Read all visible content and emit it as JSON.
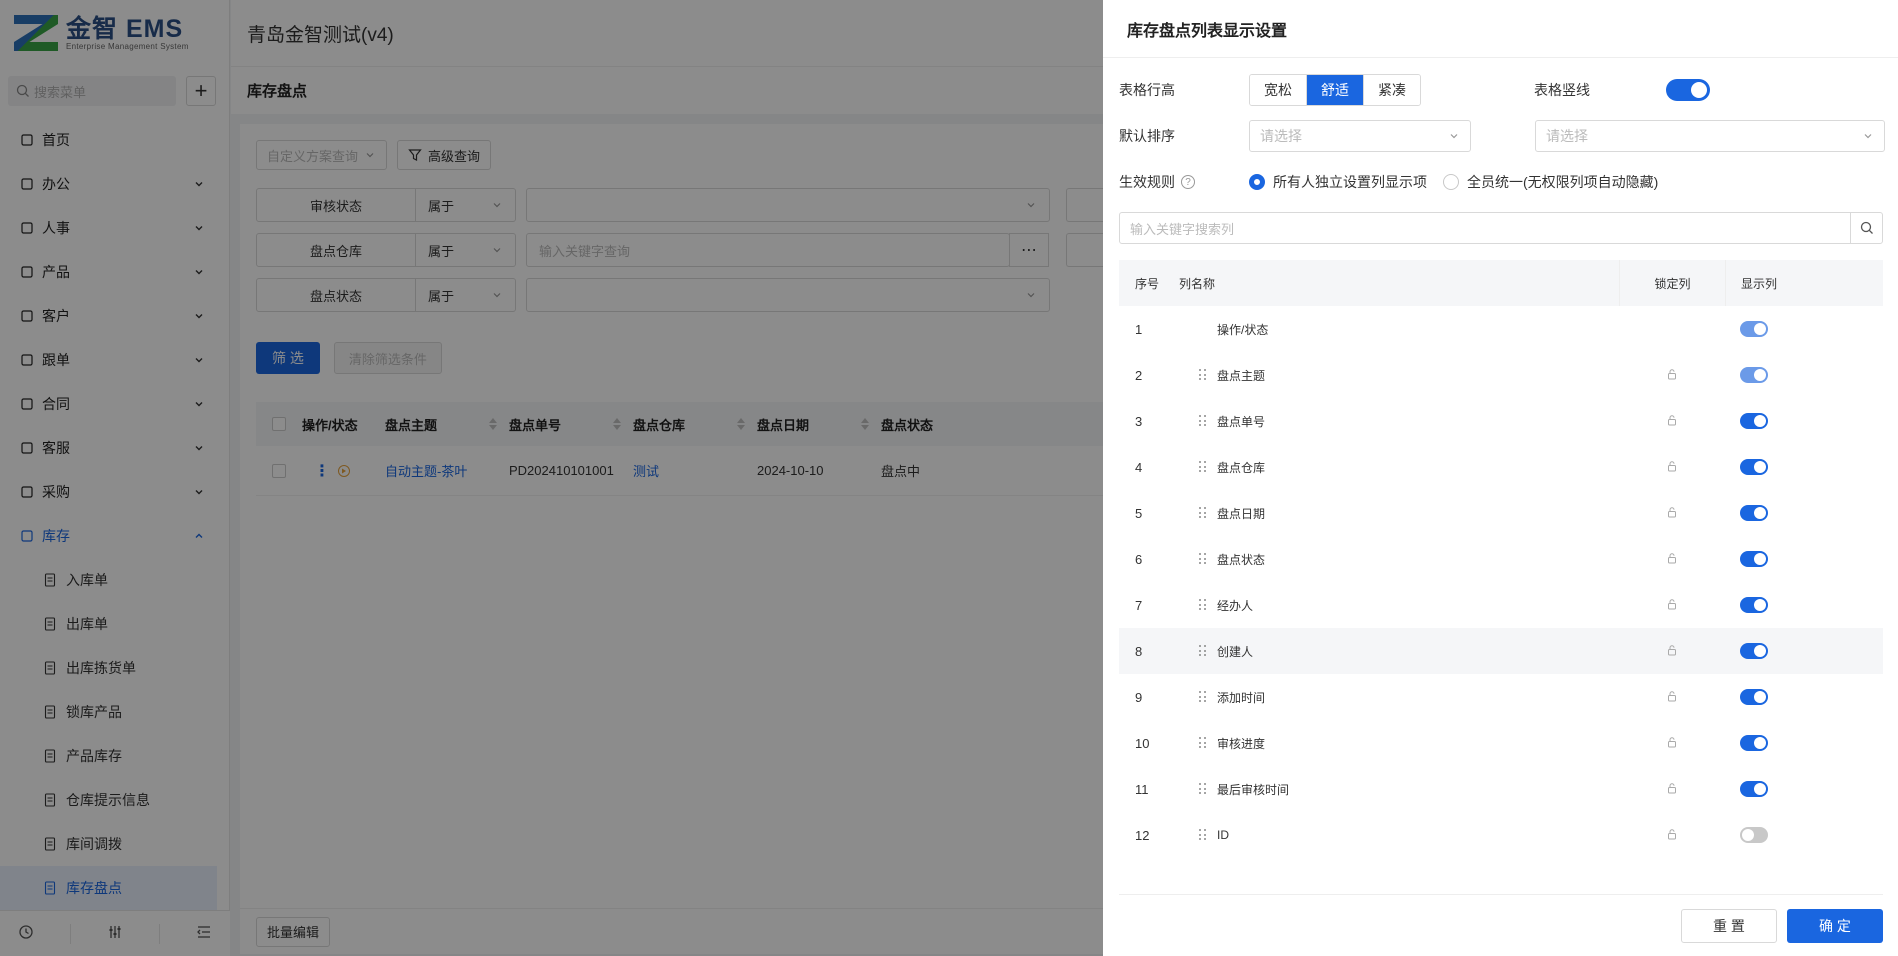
{
  "app": {
    "logo_title": "金智 EMS",
    "logo_subtitle": "Enterprise Management System",
    "company": "青岛金智测试(v4)",
    "page_title": "库存盘点"
  },
  "sidebar": {
    "search_placeholder": "搜索菜单",
    "menu": [
      {
        "label": "首页",
        "icon": "grid-icon",
        "expandable": false
      },
      {
        "label": "办公",
        "icon": "inbox-icon",
        "expandable": true
      },
      {
        "label": "人事",
        "icon": "user-group-icon",
        "expandable": true
      },
      {
        "label": "产品",
        "icon": "cube-icon",
        "expandable": true
      },
      {
        "label": "客户",
        "icon": "bar-chart-icon",
        "expandable": true
      },
      {
        "label": "跟单",
        "icon": "shield-icon",
        "expandable": true
      },
      {
        "label": "合同",
        "icon": "contract-icon",
        "expandable": true
      },
      {
        "label": "客服",
        "icon": "headset-icon",
        "expandable": true
      },
      {
        "label": "采购",
        "icon": "bag-icon",
        "expandable": true
      },
      {
        "label": "库存",
        "icon": "warehouse-icon",
        "expandable": true,
        "expanded": true
      }
    ],
    "submenu": [
      {
        "label": "入库单",
        "icon": "inbound-icon"
      },
      {
        "label": "出库单",
        "icon": "outbound-icon"
      },
      {
        "label": "出库拣货单",
        "icon": "picking-icon"
      },
      {
        "label": "锁库产品",
        "icon": "lock-doc-icon"
      },
      {
        "label": "产品库存",
        "icon": "doc-icon"
      },
      {
        "label": "仓库提示信息",
        "icon": "notice-icon"
      },
      {
        "label": "库间调拨",
        "icon": "transfer-icon"
      },
      {
        "label": "库存盘点",
        "icon": "stocktake-icon",
        "active": true
      }
    ]
  },
  "main": {
    "scheme_select": "自定义方案查询",
    "advanced_query": "高级查询",
    "filters": [
      {
        "field": "审核状态",
        "op": "属于",
        "value": ""
      },
      {
        "field": "盘点仓库",
        "op": "属于",
        "value": "输入关键字查询"
      },
      {
        "field": "盘点状态",
        "op": "属于",
        "value": ""
      }
    ],
    "filter_button": "筛 选",
    "clear_button": "清除筛选条件",
    "table": {
      "headers": [
        "操作/状态",
        "盘点主题",
        "盘点单号",
        "盘点仓库",
        "盘点日期",
        "盘点状态"
      ],
      "rows": [
        {
          "subject": "自动主题-茶叶",
          "number": "PD202410101001",
          "warehouse": "测试",
          "date": "2024-10-10",
          "status": "盘点中"
        }
      ]
    },
    "batch_edit": "批量编辑"
  },
  "drawer": {
    "title": "库存盘点列表显示设置",
    "row_height_label": "表格行高",
    "row_height_options": [
      "宽松",
      "舒适",
      "紧凑"
    ],
    "row_height_selected": "舒适",
    "vertical_lines_label": "表格竖线",
    "vertical_lines_on": true,
    "default_sort_label": "默认排序",
    "sort_placeholder_1": "请选择",
    "sort_placeholder_2": "请选择",
    "rule_label": "生效规则",
    "rule_options": [
      "所有人独立设置列显示项",
      "全员统一(无权限列项自动隐藏)"
    ],
    "rule_selected": "所有人独立设置列显示项",
    "search_placeholder": "输入关键字搜索列",
    "headers": {
      "no": "序号",
      "name": "列名称",
      "lock": "锁定列",
      "show": "显示列"
    },
    "columns": [
      {
        "no": "1",
        "name": "操作/状态",
        "show": "locked-on"
      },
      {
        "no": "2",
        "name": "盘点主题",
        "show": "locked-on"
      },
      {
        "no": "3",
        "name": "盘点单号",
        "show": "on"
      },
      {
        "no": "4",
        "name": "盘点仓库",
        "show": "on"
      },
      {
        "no": "5",
        "name": "盘点日期",
        "show": "on"
      },
      {
        "no": "6",
        "name": "盘点状态",
        "show": "on"
      },
      {
        "no": "7",
        "name": "经办人",
        "show": "on"
      },
      {
        "no": "8",
        "name": "创建人",
        "show": "on"
      },
      {
        "no": "9",
        "name": "添加时间",
        "show": "on"
      },
      {
        "no": "10",
        "name": "审核进度",
        "show": "on"
      },
      {
        "no": "11",
        "name": "最后审核时间",
        "show": "on"
      },
      {
        "no": "12",
        "name": "ID",
        "show": "off"
      }
    ],
    "reset_button": "重 置",
    "ok_button": "确 定"
  },
  "colors": {
    "primary": "#1a66e0",
    "overlay": "rgba(0,0,0,0.45)"
  }
}
